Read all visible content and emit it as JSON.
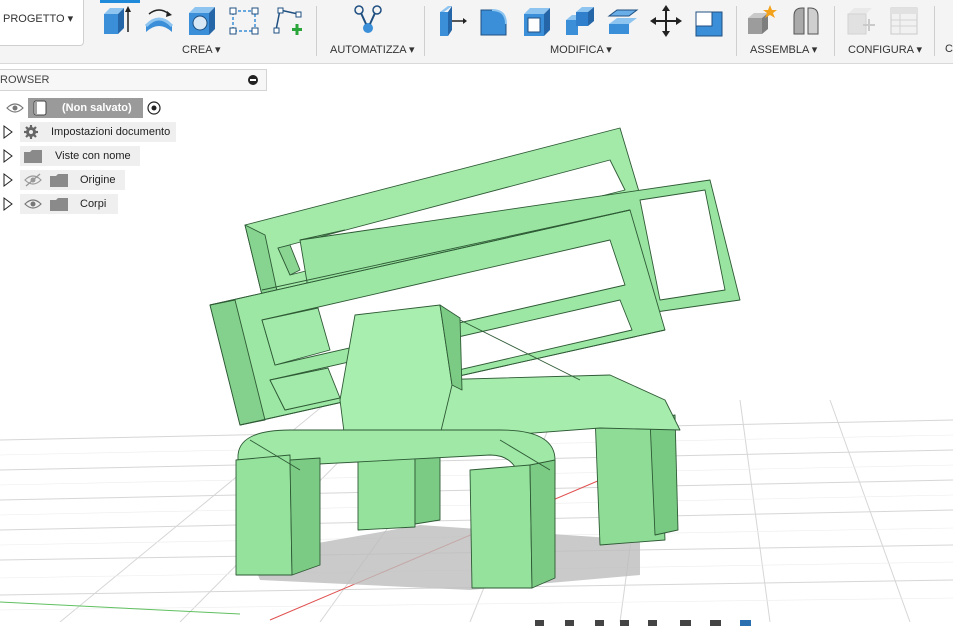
{
  "toolbar": {
    "project_menu": "PROGETTO ▾",
    "groups": [
      {
        "label": "CREA ▾"
      },
      {
        "label": "AUTOMATIZZA ▾"
      },
      {
        "label": "MODIFICA ▾"
      },
      {
        "label": "ASSEMBLA ▾"
      },
      {
        "label": "CONFIGURA ▾"
      },
      {
        "label": "C"
      }
    ],
    "icons": [
      "extrude-icon",
      "revolve-icon",
      "hole-icon",
      "sketch-rectangle-icon",
      "create-sketch-icon",
      "automate-icon",
      "press-pull-icon",
      "fillet-icon",
      "shell-icon",
      "combine-icon",
      "offset-face-icon",
      "move-icon",
      "scale-icon",
      "new-component-icon",
      "joint-icon",
      "configure-table-icon",
      "parameters-icon"
    ],
    "accent_color": "#1f8ad9"
  },
  "browser": {
    "title": "ROWSER",
    "root": {
      "label": "(Non salvato)"
    },
    "items": [
      {
        "label": "Impostazioni documento",
        "icon": "gear-icon"
      },
      {
        "label": "Viste con nome",
        "icon": "folder-icon"
      },
      {
        "label": "Origine",
        "icon": "folder-icon",
        "visibility": "hidden"
      },
      {
        "label": "Corpi",
        "icon": "folder-icon",
        "visibility": "visible"
      }
    ]
  },
  "model": {
    "color": "#93e39b",
    "edge_color": "#2e5a35"
  }
}
